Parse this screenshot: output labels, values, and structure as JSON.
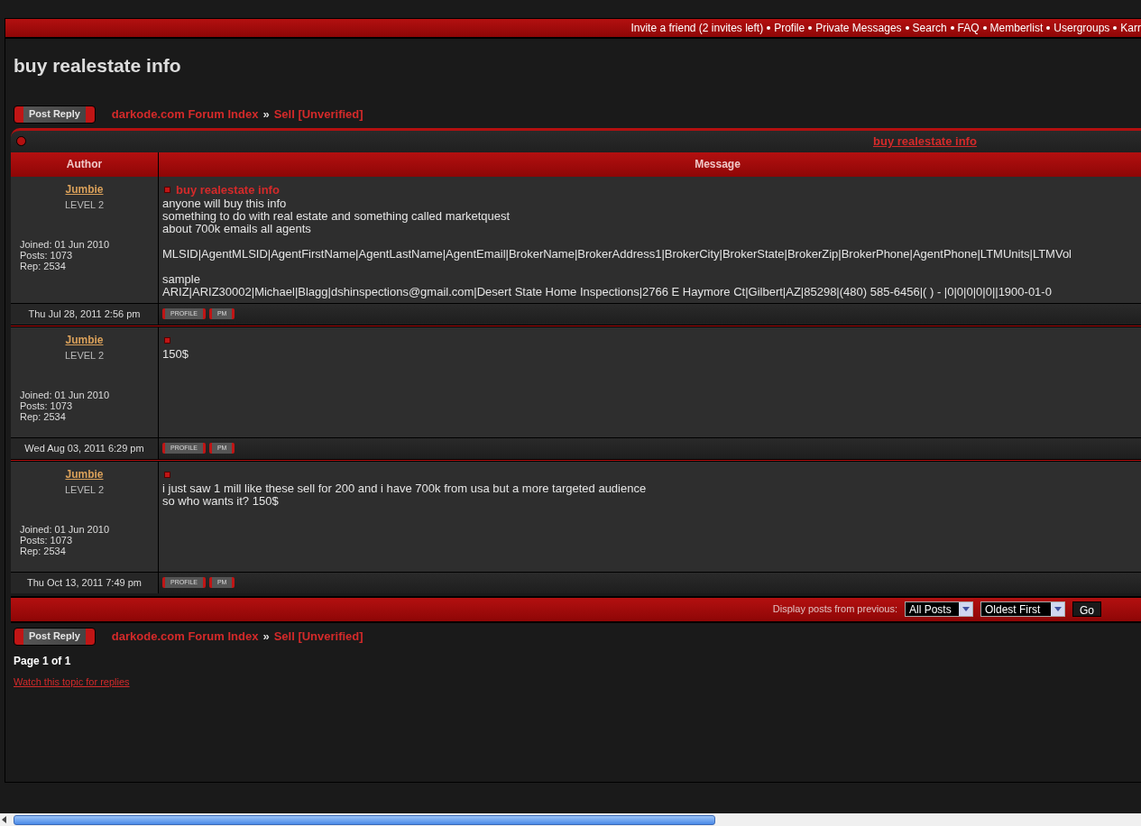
{
  "nav_links": [
    "Invite a friend (2 invites left)",
    "Profile",
    "Private Messages",
    "Search",
    "FAQ",
    "Memberlist",
    "Usergroups",
    "Karr"
  ],
  "page_title": "buy realestate info",
  "post_reply_top": "Post Reply",
  "breadcrumb_top": [
    "darkode.com Forum Index",
    "Sell [Unverified]"
  ],
  "breadcrumb_separator_top": "»",
  "topic_link": "buy realestate info",
  "columns": [
    "Author",
    "Message"
  ],
  "posts": [
    {
      "author": "Jumbie",
      "rank": "LEVEL 2",
      "joined": "Joined: 01 Jun 2010",
      "post_count": "Posts: 1073",
      "rep": "Rep: 2534",
      "date": "Thu Jul 28, 2011 2:56 pm",
      "title": "buy realestate info",
      "paragraphs": [
        [
          "anyone will buy this info",
          "something to do with real estate and something called marketquest",
          "about 700k emails all agents"
        ],
        [
          "MLSID|AgentMLSID|AgentFirstName|AgentLastName|AgentEmail|BrokerName|BrokerAddress1|BrokerCity|BrokerState|BrokerZip|BrokerPhone|AgentPhone|LTMUnits|LTMVol"
        ],
        [
          "sample",
          "ARIZ|ARIZ30002|Michael|Blagg|dshinspections@gmail.com|Desert State Home Inspections|2766 E Haymore Ct|Gilbert|AZ|85298|(480) 585-6456|( ) - |0|0|0|0|0||1900-01-0"
        ]
      ],
      "profile_button": "PROFILE",
      "pm_button": "PM"
    },
    {
      "author": "Jumbie",
      "rank": "LEVEL 2",
      "joined": "Joined: 01 Jun 2010",
      "post_count": "Posts: 1073",
      "rep": "Rep: 2534",
      "date": "Wed Aug 03, 2011 6:29 pm",
      "paragraphs": [
        [
          "150$"
        ]
      ],
      "profile_button": "PROFILE",
      "pm_button": "PM"
    },
    {
      "author": "Jumbie",
      "rank": "LEVEL 2",
      "joined": "Joined: 01 Jun 2010",
      "post_count": "Posts: 1073",
      "rep": "Rep: 2534",
      "date": "Thu Oct 13, 2011 7:49 pm",
      "paragraphs": [
        [
          "i just saw 1 mill like these sell for 200 and i have 700k from usa but a more targeted audience",
          "so who wants it? 150$"
        ]
      ],
      "profile_button": "PROFILE",
      "pm_button": "PM"
    }
  ],
  "display_label": "Display posts from previous:",
  "time_filter": "All Posts",
  "sort_order": "Oldest First",
  "go_button": "Go",
  "post_reply_bottom": "Post Reply",
  "breadcrumb_bottom": [
    "darkode.com Forum Index",
    "Sell [Unverified]"
  ],
  "breadcrumb_separator_bottom": "»",
  "pagination": "Page 1 of 1",
  "watch_link": "Watch this topic for replies"
}
